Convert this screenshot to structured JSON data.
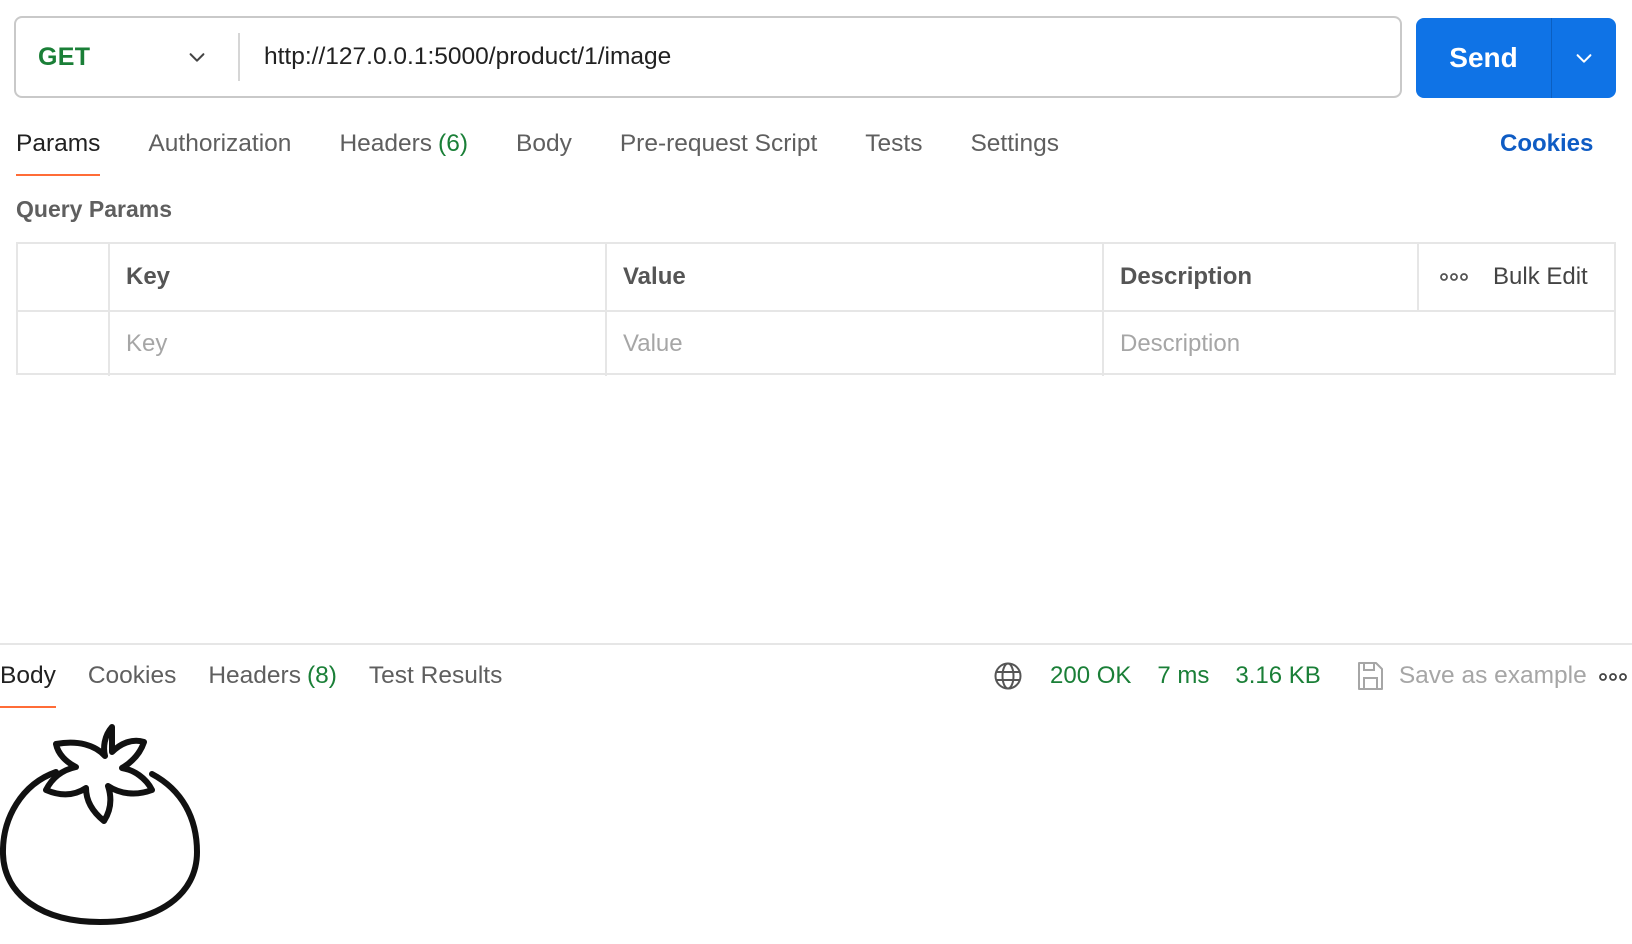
{
  "request": {
    "method": "GET",
    "url": "http://127.0.0.1:5000/product/1/image",
    "send_label": "Send"
  },
  "request_tabs": [
    {
      "label": "Params",
      "count": ""
    },
    {
      "label": "Authorization",
      "count": ""
    },
    {
      "label": "Headers",
      "count": "(6)"
    },
    {
      "label": "Body",
      "count": ""
    },
    {
      "label": "Pre-request Script",
      "count": ""
    },
    {
      "label": "Tests",
      "count": ""
    },
    {
      "label": "Settings",
      "count": ""
    }
  ],
  "cookies_link": "Cookies",
  "query_params": {
    "title": "Query Params",
    "headers": {
      "key": "Key",
      "value": "Value",
      "description": "Description"
    },
    "bulk_edit": "Bulk Edit",
    "placeholders": {
      "key": "Key",
      "value": "Value",
      "description": "Description"
    }
  },
  "response": {
    "tabs": [
      {
        "label": "Body",
        "count": ""
      },
      {
        "label": "Cookies",
        "count": ""
      },
      {
        "label": "Headers",
        "count": "(8)"
      },
      {
        "label": "Test Results",
        "count": ""
      }
    ],
    "status": "200 OK",
    "time": "7 ms",
    "size": "3.16 KB",
    "save_as_example": "Save as example",
    "body_image": "tomato-icon"
  },
  "colors": {
    "accent_blue": "#0f73e6",
    "method_green": "#1a7f37",
    "active_tab_underline": "#ff6c37",
    "link_blue": "#0f5cc4"
  }
}
